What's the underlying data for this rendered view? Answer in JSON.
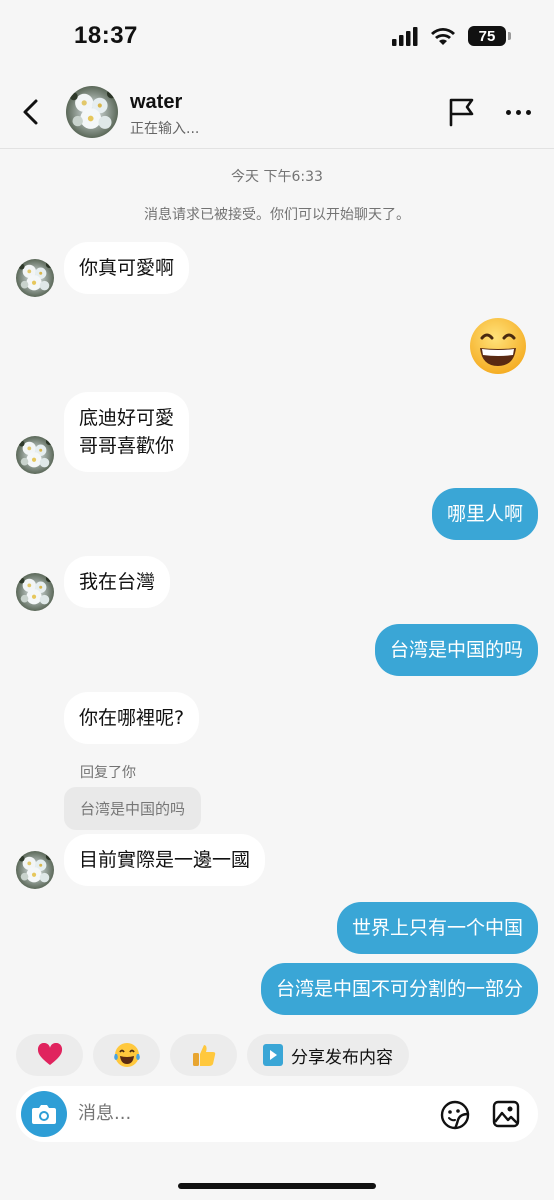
{
  "status_bar": {
    "time": "18:37",
    "battery": "75"
  },
  "header": {
    "name": "water",
    "status": "正在输入..."
  },
  "meta": {
    "date": "今天 下午6:33",
    "notice": "消息请求已被接受。你们可以开始聊天了。"
  },
  "messages": {
    "m1": "你真可愛啊",
    "m2_line1": "底迪好可愛",
    "m2_line2": "哥哥喜歡你",
    "m3": "哪里人啊",
    "m4": "我在台灣",
    "m5": "台湾是中国的吗",
    "m6": "你在哪裡呢?",
    "reply_label": "回复了你",
    "quoted": "台湾是中国的吗",
    "m7": "目前實際是一邊一國",
    "m8": "世界上只有一个中国",
    "m9": "台湾是中国不可分割的一部分"
  },
  "quick_reactions": {
    "heart": "heart-emoji",
    "laugh": "tears-of-joy-emoji",
    "thumbs": "thumbs-up-emoji",
    "share_label": "分享发布内容"
  },
  "composer": {
    "placeholder": "消息..."
  },
  "colors": {
    "outgoing_bubble": "#3aa6d6",
    "camera": "#2e9ed6",
    "background": "#f6f6f6"
  }
}
